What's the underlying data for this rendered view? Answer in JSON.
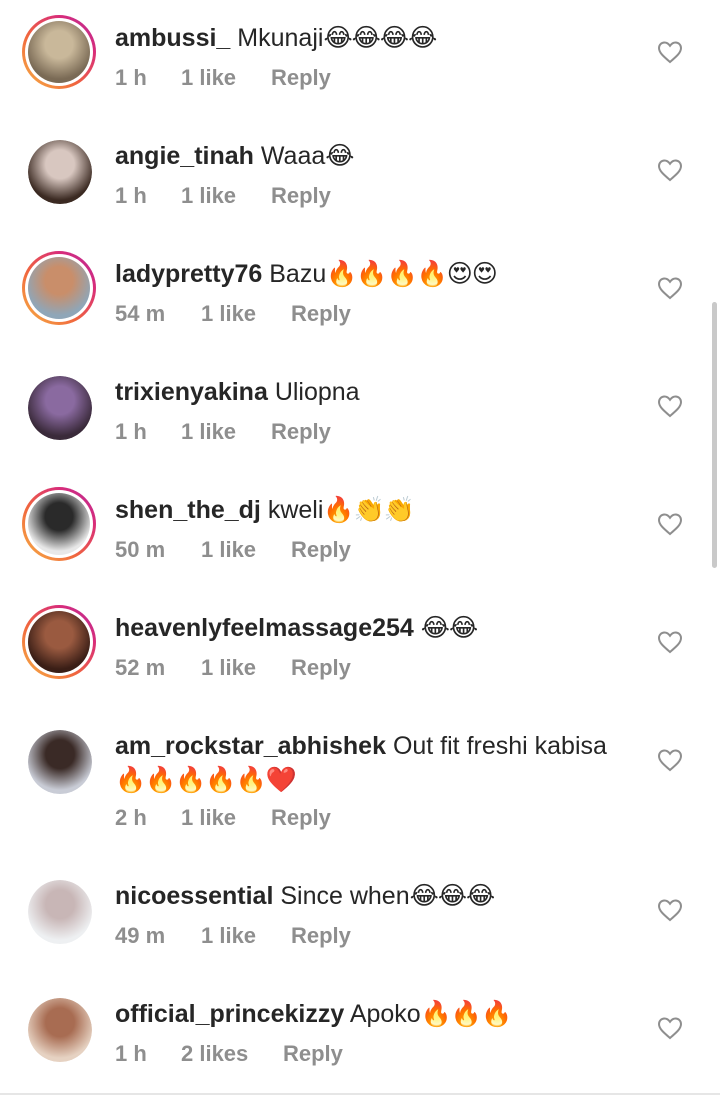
{
  "comments": [
    {
      "username": "ambussi_",
      "text": "Mkunaji",
      "emoji": "😂😂😂😂",
      "time": "1 h",
      "likes": "1 like",
      "reply": "Reply",
      "story_ring": true,
      "avatar_colors": [
        "#7a6a55",
        "#c9b89a"
      ]
    },
    {
      "username": "angie_tinah",
      "text": "Waaa",
      "emoji": "😂",
      "time": "1 h",
      "likes": "1 like",
      "reply": "Reply",
      "story_ring": false,
      "avatar_colors": [
        "#3b2a22",
        "#d8c7c0"
      ]
    },
    {
      "username": "ladypretty76",
      "text": "Bazu",
      "emoji": "🔥🔥🔥🔥😍😍",
      "time": "54 m",
      "likes": "1 like",
      "reply": "Reply",
      "story_ring": true,
      "avatar_colors": [
        "#8fa6b8",
        "#c98e6a"
      ]
    },
    {
      "username": "trixienyakina",
      "text": "Uliopna",
      "emoji": "",
      "time": "1 h",
      "likes": "1 like",
      "reply": "Reply",
      "story_ring": false,
      "avatar_colors": [
        "#3a2a3a",
        "#8a6aa0"
      ]
    },
    {
      "username": "shen_the_dj",
      "text": "kweli",
      "emoji": "🔥👏👏",
      "time": "50 m",
      "likes": "1 like",
      "reply": "Reply",
      "story_ring": true,
      "avatar_colors": [
        "#e8e8e8",
        "#2a2a2a"
      ]
    },
    {
      "username": "heavenlyfeelmassage254",
      "text": "",
      "emoji": "😂😂",
      "time": "52 m",
      "likes": "1 like",
      "reply": "Reply",
      "story_ring": true,
      "avatar_colors": [
        "#3a1e16",
        "#9a5a40"
      ]
    },
    {
      "username": "am_rockstar_abhishek",
      "text": "Out fit freshi kabisa",
      "emoji": "🔥🔥🔥🔥🔥❤️",
      "time": "2 h",
      "likes": "1 like",
      "reply": "Reply",
      "story_ring": false,
      "avatar_colors": [
        "#c9ccd6",
        "#3a2a26"
      ]
    },
    {
      "username": "nicoessential",
      "text": "Since when",
      "emoji": "😂😂😂",
      "time": "49 m",
      "likes": "1 like",
      "reply": "Reply",
      "story_ring": false,
      "avatar_colors": [
        "#eef0f2",
        "#c8b6b6"
      ]
    },
    {
      "username": "official_princekizzy",
      "text": "Apoko",
      "emoji": "🔥🔥🔥",
      "time": "1 h",
      "likes": "2 likes",
      "reply": "Reply",
      "story_ring": false,
      "avatar_colors": [
        "#e6d2c2",
        "#a86c52"
      ]
    }
  ],
  "icons": {
    "like": "heart-outline-icon"
  },
  "colors": {
    "username": "#262626",
    "meta": "#8e8e8e",
    "heart": "#8e8e8e"
  }
}
